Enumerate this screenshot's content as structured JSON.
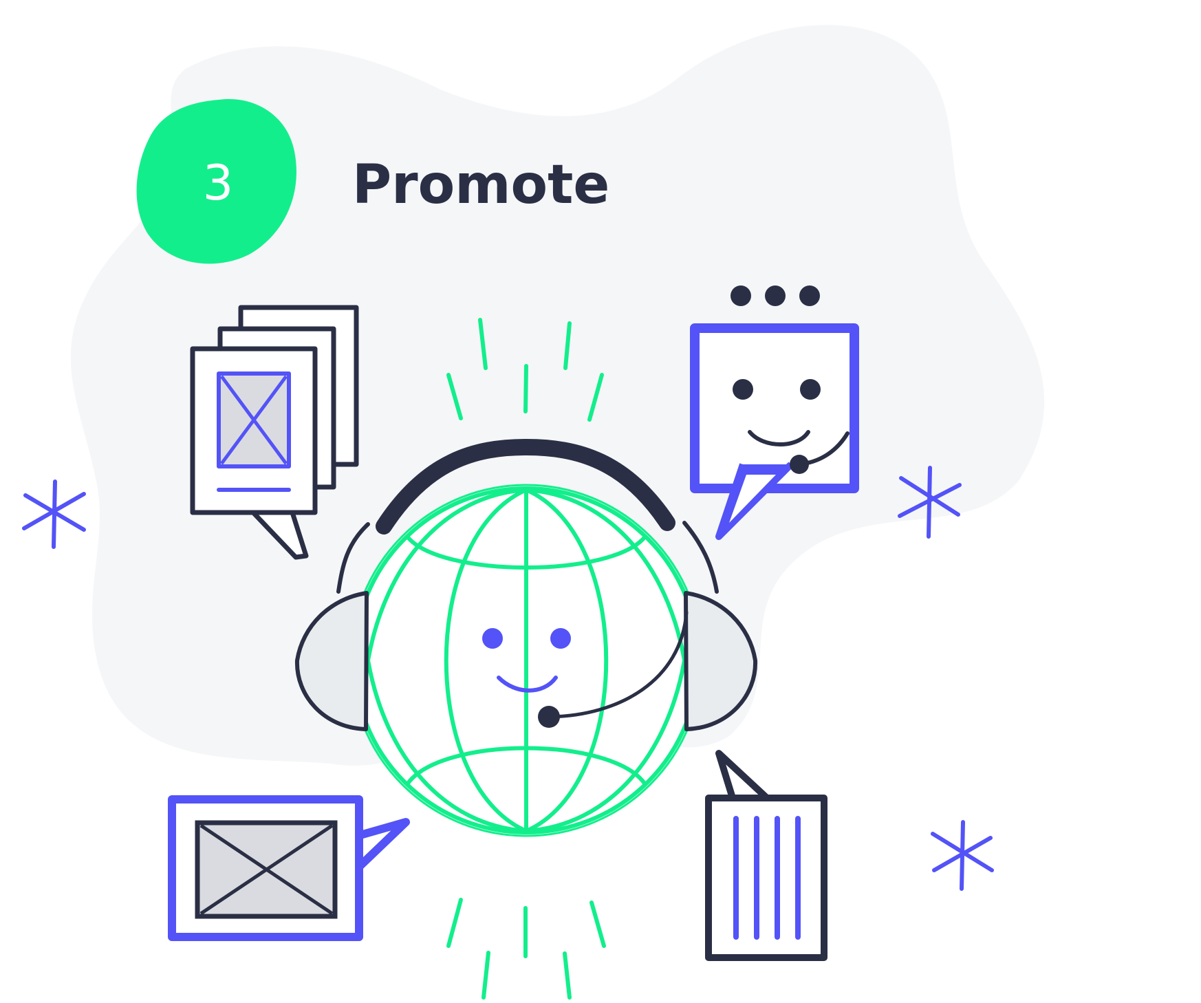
{
  "step": {
    "number": "3",
    "title": "Promote"
  },
  "colors": {
    "blob": "#f5f6f8",
    "green": "#13ee8c",
    "ink": "#2a2f45",
    "purple": "#5353f7",
    "gray_fill": "#dadbe0",
    "cup_fill": "#e9ecee"
  },
  "icons": [
    "globe-icon",
    "headset-icon",
    "image-cards-icon",
    "chat-face-icon",
    "image-card-icon",
    "bars-card-icon",
    "sparkle-icon",
    "typing-dots-icon"
  ]
}
